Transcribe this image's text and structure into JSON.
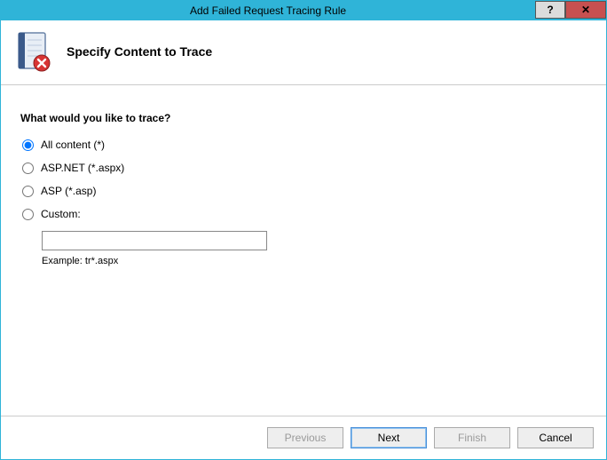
{
  "window": {
    "title": "Add Failed Request Tracing Rule"
  },
  "header": {
    "title": "Specify Content to Trace"
  },
  "content": {
    "question": "What would you like to trace?",
    "options": {
      "all": "All content (*)",
      "aspnet": "ASP.NET (*.aspx)",
      "asp": "ASP (*.asp)",
      "custom": "Custom:"
    },
    "custom_value": "",
    "example": "Example: tr*.aspx"
  },
  "footer": {
    "previous": "Previous",
    "next": "Next",
    "finish": "Finish",
    "cancel": "Cancel"
  }
}
